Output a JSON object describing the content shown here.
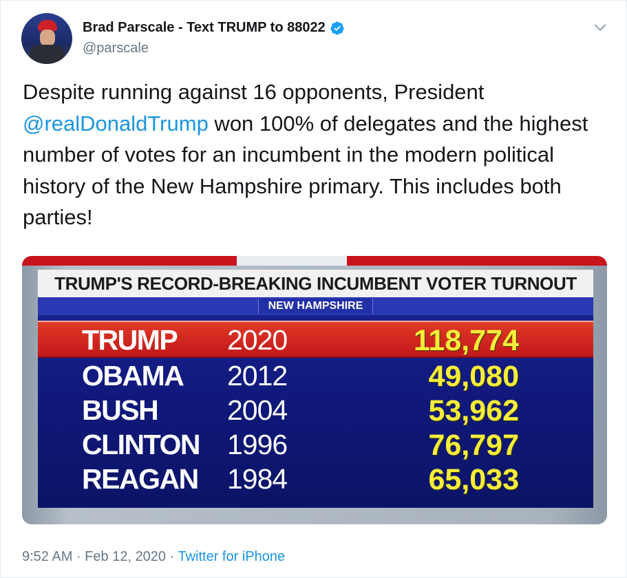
{
  "author": {
    "name": "Brad Parscale - Text TRUMP to 88022",
    "handle": "@parscale"
  },
  "tweet": {
    "text_before": "Despite running against 16 opponents, President ",
    "mention": "@realDonaldTrump",
    "text_after": " won 100% of delegates and the highest number of votes for an incumbent in the modern political history of the New Hampshire primary. This includes both parties!"
  },
  "media": {
    "title": "TRUMP'S RECORD-BREAKING INCUMBENT VOTER TURNOUT",
    "subtitle": "NEW HAMPSHIRE",
    "rows": [
      {
        "candidate": "TRUMP",
        "year": "2020",
        "votes": "118,774"
      },
      {
        "candidate": "OBAMA",
        "year": "2012",
        "votes": "49,080"
      },
      {
        "candidate": "BUSH",
        "year": "2004",
        "votes": "53,962"
      },
      {
        "candidate": "CLINTON",
        "year": "1996",
        "votes": "76,797"
      },
      {
        "candidate": "REAGAN",
        "year": "1984",
        "votes": "65,033"
      }
    ]
  },
  "footer": {
    "time": "9:52 AM",
    "sep1": " · ",
    "date": "Feb 12, 2020",
    "sep2": " · ",
    "source": "Twitter for iPhone"
  },
  "colors": {
    "link": "#1b95e0",
    "verified": "#1da1f2",
    "highlight_row": "#c2181a",
    "votes_text": "#f6ee3a"
  },
  "icons": {
    "verified": "verified-badge-icon",
    "caret": "chevron-down-icon"
  }
}
